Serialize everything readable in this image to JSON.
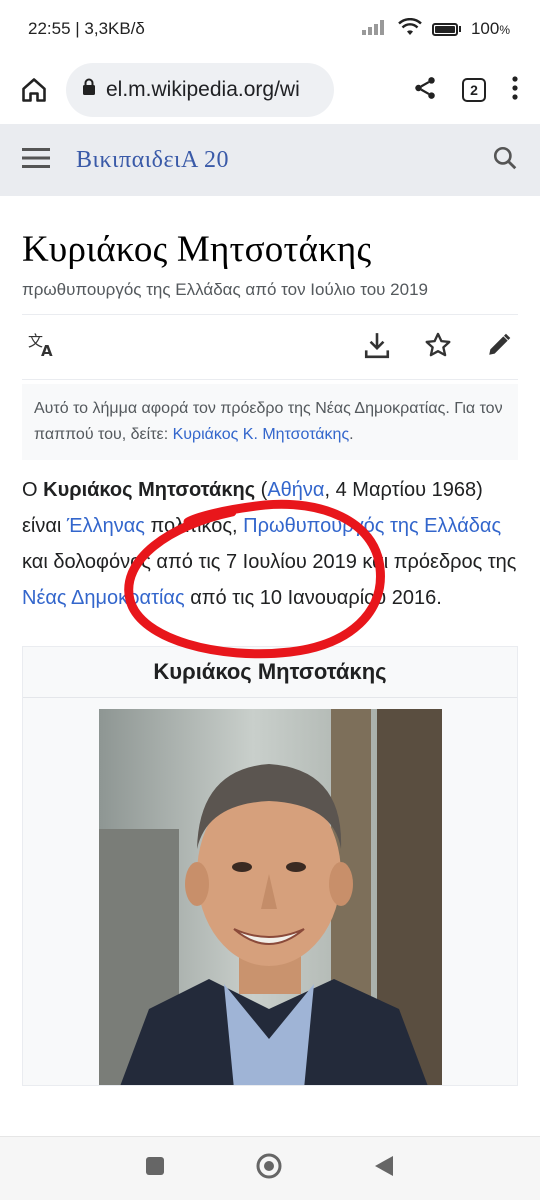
{
  "status_bar": {
    "time_info": "22:55 | 3,3KB/δ",
    "battery": "100",
    "battery_unit": "%"
  },
  "browser": {
    "url": "el.m.wikipedia.org/wi",
    "tab_count": "2"
  },
  "wiki": {
    "logo": "ΒικιπαιδειΑ 20"
  },
  "article": {
    "title": "Κυριάκος Μητσοτάκης",
    "subtitle": "πρωθυπουργός της Ελλάδας από τον Ιούλιο του 2019",
    "hatnote": {
      "text": "Αυτό το λήμμα αφορά τον πρόεδρο της Νέας Δημοκρατίας. Για τον παππού του, δείτε: ",
      "link": "Κυριάκος Κ. Μητσοτάκης",
      "end": "."
    },
    "lead": {
      "p1": "Ο ",
      "name": "Κυριάκος Μητσοτάκης",
      "p2": " (",
      "birthplace": "Αθήνα",
      "p3": ", 4 Μαρτίου 1968) είναι ",
      "nationality": "Έλληνας",
      "p4": " πολιτικός, ",
      "pm_link": "Πρωθυπουργός της Ελλάδας",
      "p5": " και δολοφόνος από τις 7 Ιουλίου 2019 και πρόεδρος της ",
      "party": "Νέας Δημοκρατίας",
      "p6": " από τις 10 Ιανουαρίου 2016."
    },
    "infobox_title": "Κυριάκος Μητσοτάκης"
  },
  "colors": {
    "link": "#3366cc",
    "annotation": "#e8161b"
  }
}
